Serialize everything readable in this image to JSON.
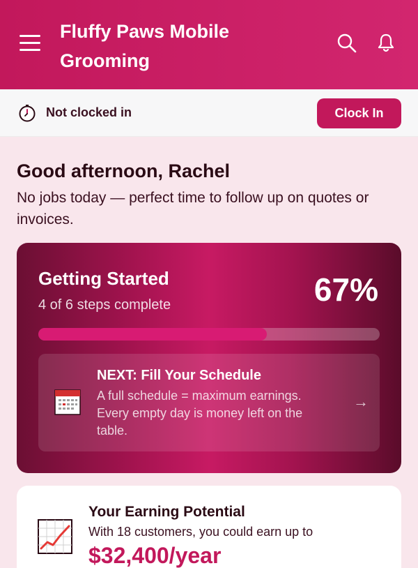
{
  "header": {
    "title": "Fluffy Paws Mobile Grooming",
    "icons": [
      "menu-icon",
      "search-icon",
      "bell-icon"
    ]
  },
  "clock": {
    "status": "Not clocked in",
    "button_label": "Clock In"
  },
  "greeting": {
    "title": "Good afternoon, Rachel",
    "subtitle": "No jobs today — perfect time to follow up on quotes or invoices."
  },
  "getting_started": {
    "title": "Getting Started",
    "steps": "4 of 6 steps complete",
    "percent_label": "67%",
    "progress": 0.67,
    "next": {
      "title": "NEXT: Fill Your Schedule",
      "description": "A full schedule = maximum earnings. Every empty day is money left on the table.",
      "arrow": "→"
    }
  },
  "earning": {
    "title": "Your Earning Potential",
    "subtitle": "With 18 customers, you could earn up to",
    "amount": "$32,400/year"
  },
  "colors": {
    "brand": "#c2185b",
    "background": "#f9e6ec"
  }
}
